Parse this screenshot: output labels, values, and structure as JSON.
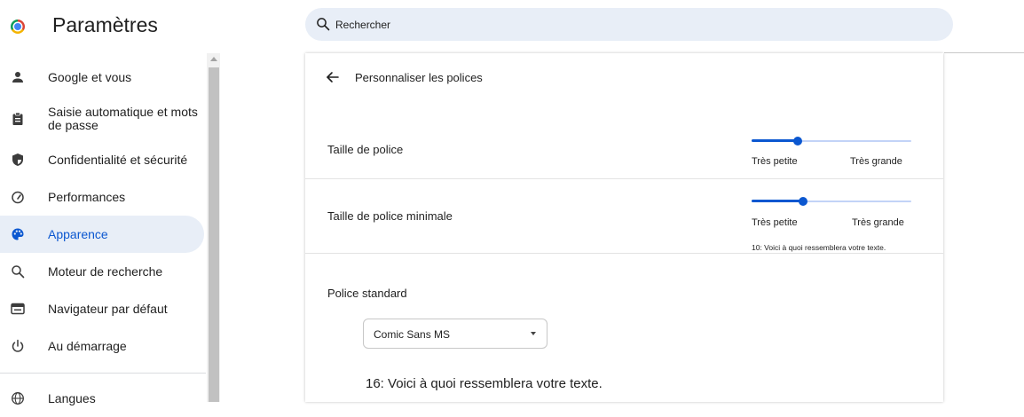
{
  "app": {
    "title": "Paramètres"
  },
  "search": {
    "placeholder": "Rechercher",
    "icon": "search-icon"
  },
  "sidebar": {
    "items": [
      {
        "label": "Google et vous",
        "icon": "person-icon"
      },
      {
        "label": "Saisie automatique et mots de passe",
        "icon": "clipboard-icon"
      },
      {
        "label": "Confidentialité et sécurité",
        "icon": "shield-icon"
      },
      {
        "label": "Performances",
        "icon": "speedometer-icon"
      },
      {
        "label": "Apparence",
        "icon": "palette-icon",
        "active": true
      },
      {
        "label": "Moteur de recherche",
        "icon": "search-icon"
      },
      {
        "label": "Navigateur par défaut",
        "icon": "browser-icon"
      },
      {
        "label": "Au démarrage",
        "icon": "power-icon"
      },
      {
        "label": "Langues",
        "icon": "globe-icon"
      }
    ]
  },
  "page": {
    "title": "Personnaliser les polices",
    "font_size": {
      "label": "Taille de police",
      "min_label": "Très petite",
      "max_label": "Très grande",
      "value_fraction": 0.29
    },
    "min_font_size": {
      "label": "Taille de police minimale",
      "min_label": "Très petite",
      "max_label": "Très grande",
      "value_fraction": 0.32,
      "preview": "10: Voici à quoi ressemblera votre texte."
    },
    "standard_font": {
      "title": "Police standard",
      "selected": "Comic Sans MS",
      "preview": "16: Voici à quoi ressemblera votre texte."
    }
  },
  "colors": {
    "accent": "#0b57d0",
    "active_bg": "#e8eef7",
    "slider_track": "#c2d3f7"
  }
}
